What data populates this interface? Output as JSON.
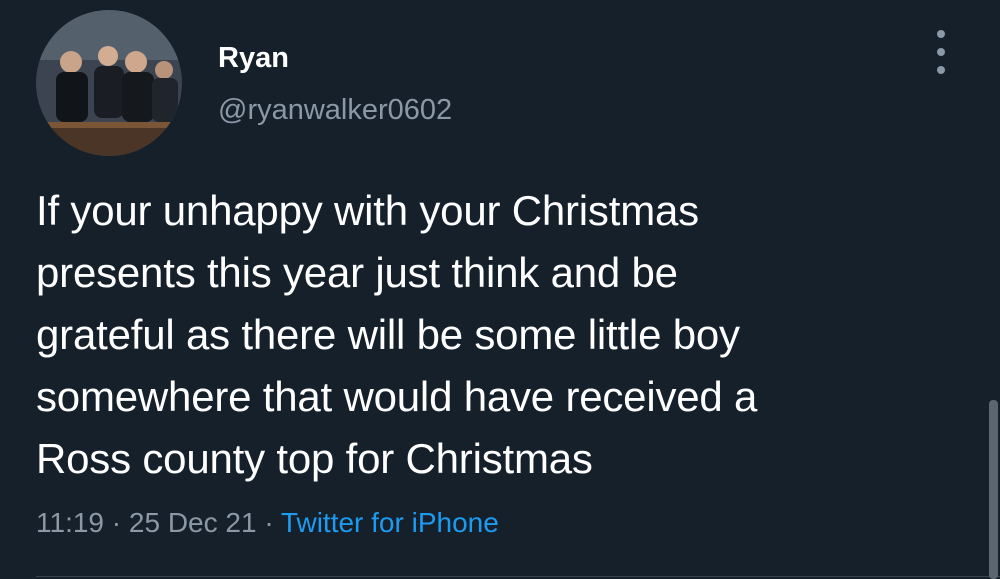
{
  "tweet": {
    "author": {
      "name": "Ryan",
      "handle": "@ryanwalker0602"
    },
    "text": "If your unhappy with your Christmas\npresents this year just think and be\ngrateful as there will be some little boy\nsomewhere that would have received a\nRoss county top for Christmas",
    "time": "11:19",
    "date": "25 Dec 21",
    "separator": "·",
    "source": "Twitter for iPhone"
  },
  "icons": {
    "more": "more-options-icon"
  },
  "colors": {
    "background": "#15202b",
    "primary_text": "#ffffff",
    "secondary_text": "#8b98a5",
    "link": "#1d9bf0"
  }
}
